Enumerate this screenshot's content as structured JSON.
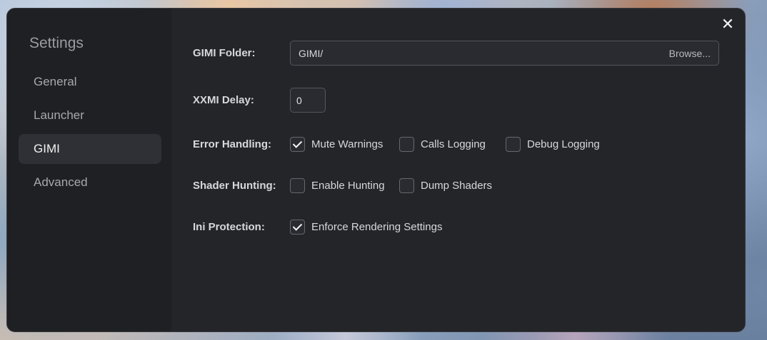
{
  "sidebar": {
    "title": "Settings",
    "items": [
      {
        "label": "General"
      },
      {
        "label": "Launcher"
      },
      {
        "label": "GIMI"
      },
      {
        "label": "Advanced"
      }
    ],
    "active_item": "GIMI"
  },
  "settings": {
    "folder": {
      "label": "GIMI Folder:",
      "value": "GIMI/",
      "browse": "Browse..."
    },
    "delay": {
      "label": "XXMI Delay:",
      "value": "0"
    },
    "error_handling": {
      "label": "Error Handling:",
      "options": [
        {
          "label": "Mute Warnings",
          "checked": true
        },
        {
          "label": "Calls Logging",
          "checked": false
        },
        {
          "label": "Debug Logging",
          "checked": false
        }
      ]
    },
    "shader_hunting": {
      "label": "Shader Hunting:",
      "options": [
        {
          "label": "Enable Hunting",
          "checked": false
        },
        {
          "label": "Dump Shaders",
          "checked": false
        }
      ]
    },
    "ini_protection": {
      "label": "Ini Protection:",
      "options": [
        {
          "label": "Enforce Rendering Settings",
          "checked": true
        }
      ]
    }
  },
  "icons": {
    "close": "close-icon",
    "check": "checkmark-icon"
  }
}
